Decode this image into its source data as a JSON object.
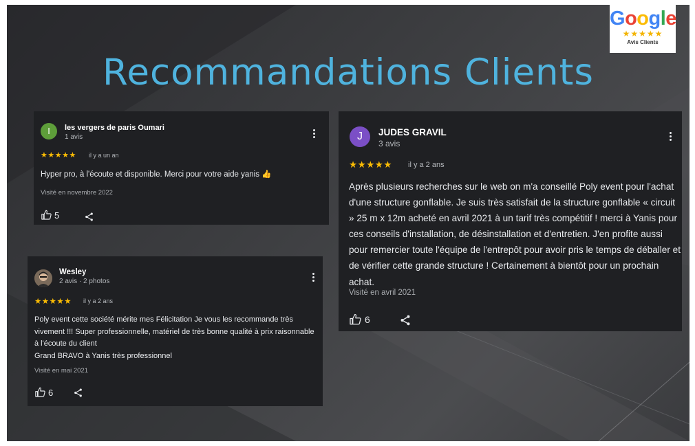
{
  "slide": {
    "title": "Recommandations Clients"
  },
  "badge": {
    "letters": [
      "G",
      "o",
      "o",
      "g",
      "l",
      "e"
    ],
    "letter_colors": [
      "#4285f4",
      "#ea4335",
      "#fbbc05",
      "#4285f4",
      "#34a853",
      "#ea4335"
    ],
    "stars": "★★★★★",
    "caption": "Avis Clients"
  },
  "reviews": [
    {
      "avatar_letter": "I",
      "avatar_color": "#5e9e3a",
      "name": "les vergers de paris Oumari",
      "meta": "1 avis",
      "stars": "★★★★★",
      "ago": "il y a un an",
      "text": "Hyper pro, à l'écoute et disponible. Merci pour votre aide yanis 👍",
      "visit": "Visité en novembre 2022",
      "likes": "5"
    },
    {
      "avatar_letter": "J",
      "avatar_color": "#7b4fc6",
      "name": "JUDES GRAVIL",
      "meta": "3 avis",
      "stars": "★★★★★",
      "ago": "il y a 2 ans",
      "text": "Après plusieurs recherches sur le web on m'a conseillé Poly event pour l'achat d'une structure gonflable. Je suis très satisfait de la structure gonflable « circuit » 25 m x 12m acheté en avril 2021 à un tarif très compétitif ! merci à Yanis pour ces conseils d'installation, de désinstallation et d'entretien. J'en profite aussi pour remercier toute l'équipe de l'entrepôt pour avoir pris le temps de déballer et de vérifier cette grande structure ! Certainement à bientôt pour un prochain achat.",
      "visit": "Visité en avril 2021",
      "likes": "6"
    },
    {
      "avatar_letter": "",
      "avatar_color": "#8a7a6a",
      "name": "Wesley",
      "meta": "2 avis · 2 photos",
      "stars": "★★★★★",
      "ago": "il y a 2 ans",
      "text": "Poly event cette société mérite mes Félicitation Je vous les recommande très vivement !!! Super professionnelle, matériel de très bonne qualité à prix raisonnable à l'écoute du client\nGrand BRAVO à Yanis très professionnel",
      "visit": "Visité en mai 2021",
      "likes": "6"
    }
  ]
}
